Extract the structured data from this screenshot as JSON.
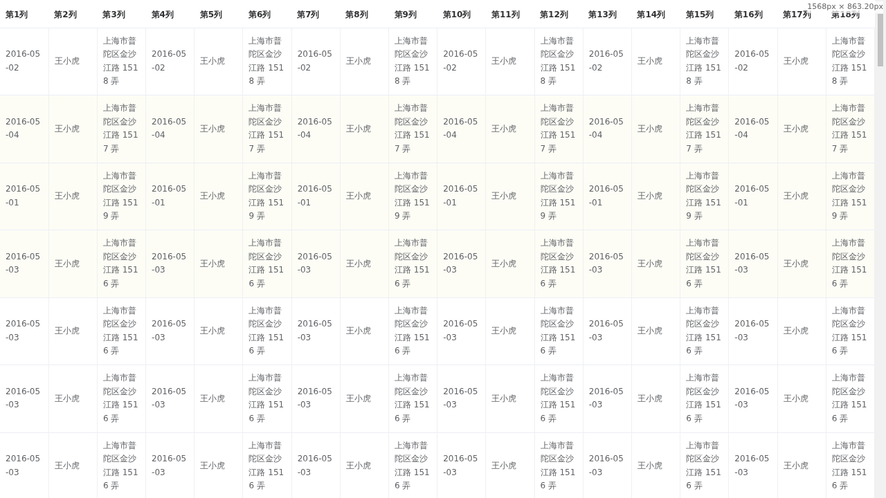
{
  "table": {
    "columns": [
      "第1列",
      "第2列",
      "第3列",
      "第4列",
      "第5列",
      "第6列",
      "第7列",
      "第8列",
      "第9列",
      "第10列",
      "第11列",
      "第12列",
      "第13列",
      "第14列",
      "第15列",
      "第16列",
      "第17列",
      "第18列"
    ],
    "rows": [
      {
        "cells": [
          "2016-05-02",
          "王小虎",
          "上海市普陀区金沙江路 1518 弄",
          "2016-05-02",
          "王小虎",
          "上海市普陀区金沙江路 1518 弄",
          "2016-05-02",
          "王小虎",
          "上海市普陀区金沙江路 1518 弄",
          "2016-05-02",
          "王小虎",
          "上海市普陀区金沙江路 1518 弄",
          "2016-05-02",
          "王小虎",
          "上海市普陀区金沙江路 1518 弄",
          "2016-05-02",
          "王小虎",
          "上海市普陀区金沙江路 1518 弄"
        ]
      },
      {
        "cells": [
          "2016-05-04",
          "王小虎",
          "上海市普陀区金沙江路 1517 弄",
          "2016-05-04",
          "王小虎",
          "上海市普陀区金沙江路 1517 弄",
          "2016-05-04",
          "王小虎",
          "上海市普陀区金沙江路 1517 弄",
          "2016-05-04",
          "王小虎",
          "上海市普陀区金沙江路 1517 弄",
          "2016-05-04",
          "王小虎",
          "上海市普陀区金沙江路 1517 弄",
          "2016-05-04",
          "王小虎",
          "上海市普陀区金沙江路 1517 弄"
        ]
      },
      {
        "cells": [
          "2016-05-01",
          "王小虎",
          "上海市普陀区金沙江路 1519 弄",
          "2016-05-01",
          "王小虎",
          "上海市普陀区金沙江路 1519 弄",
          "2016-05-01",
          "王小虎",
          "上海市普陀区金沙江路 1519 弄",
          "2016-05-01",
          "王小虎",
          "上海市普陀区金沙江路 1519 弄",
          "2016-05-01",
          "王小虎",
          "上海市普陀区金沙江路 1519 弄",
          "2016-05-01",
          "王小虎",
          "上海市普陀区金沙江路 1519 弄"
        ]
      },
      {
        "cells": [
          "2016-05-03",
          "王小虎",
          "上海市普陀区金沙江路 1516 弄",
          "2016-05-03",
          "王小虎",
          "上海市普陀区金沙江路 1516 弄",
          "2016-05-03",
          "王小虎",
          "上海市普陀区金沙江路 1516 弄",
          "2016-05-03",
          "王小虎",
          "上海市普陀区金沙江路 1516 弄",
          "2016-05-03",
          "王小虎",
          "上海市普陀区金沙江路 1516 弄",
          "2016-05-03",
          "王小虎",
          "上海市普陀区金沙江路 1516 弄"
        ]
      },
      {
        "cells": [
          "2016-05-03",
          "王小虎",
          "上海市普陀区金沙江路 1516 弄",
          "2016-05-03",
          "王小虎",
          "上海市普陀区金沙江路 1516 弄",
          "2016-05-03",
          "王小虎",
          "上海市普陀区金沙江路 1516 弄",
          "2016-05-03",
          "王小虎",
          "上海市普陀区金沙江路 1516 弄",
          "2016-05-03",
          "王小虎",
          "上海市普陀区金沙江路 1516 弄",
          "2016-05-03",
          "王小虎",
          "上海市普陀区金沙江路 1516 弄"
        ]
      },
      {
        "cells": [
          "2016-05-03",
          "王小虎",
          "上海市普陀区金沙江路 1516 弄",
          "2016-05-03",
          "王小虎",
          "上海市普陀区金沙江路 1516 弄",
          "2016-05-03",
          "王小虎",
          "上海市普陀区金沙江路 1516 弄",
          "2016-05-03",
          "王小虎",
          "上海市普陀区金沙江路 1516 弄",
          "2016-05-03",
          "王小虎",
          "上海市普陀区金沙江路 1516 弄",
          "2016-05-03",
          "王小虎",
          "上海市普陀区金沙江路 1516 弄"
        ]
      },
      {
        "cells": [
          "2016-05-03",
          "王小虎",
          "上海市普陀区金沙江路 1516 弄",
          "2016-05-03",
          "王小虎",
          "上海市普陀区金沙江路 1516 弄",
          "2016-05-03",
          "王小虎",
          "上海市普陀区金沙江路 1516 弄",
          "2016-05-03",
          "王小虎",
          "上海市普陀区金沙江路 1516 弄",
          "2016-05-03",
          "王小虎",
          "上海市普陀区金沙江路 1516 弄",
          "2016-05-03",
          "王小虎",
          "上海市普陀区金沙江路 1516 弄"
        ]
      }
    ]
  },
  "size_tooltip": "1568px × 863.20px"
}
